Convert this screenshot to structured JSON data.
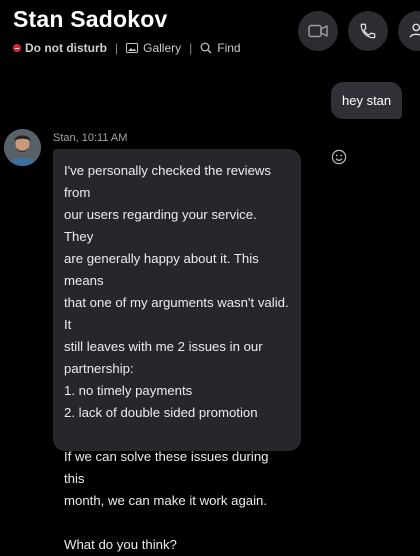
{
  "header": {
    "title": "Stan Sadokov",
    "status": "Do not disturb",
    "separator": "|",
    "gallery_label": "Gallery",
    "find_label": "Find"
  },
  "actions": {
    "video_icon": "video-camera-icon",
    "call_icon": "phone-icon",
    "more_icon": "person-icon"
  },
  "messages": {
    "outgoing": {
      "text": "hey stan"
    },
    "incoming": {
      "meta": "Stan, 10:11 AM",
      "lines": [
        "I've personally checked the reviews from",
        "our users regarding your service. They",
        "are generally happy about it. This means",
        "that one of my arguments wasn't valid. It",
        "still leaves with me 2 issues in our",
        "partnership:",
        "1. no timely payments",
        "2. lack of double sided promotion",
        "",
        "If we can solve these issues during this",
        "month, we can make it work again.",
        "",
        "What do you think?"
      ]
    }
  },
  "colors": {
    "background": "#000000",
    "bubble_incoming": "#26272b",
    "bubble_outgoing": "#2f3136",
    "dnd_red": "#d9263b",
    "button": "#2b2d31"
  }
}
